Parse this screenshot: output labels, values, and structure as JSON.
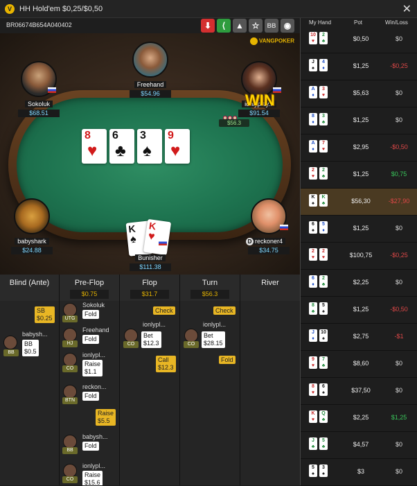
{
  "window": {
    "title": "HH Hold'em $0,25/$0,50",
    "logo_letter": "V",
    "close_glyph": "✕"
  },
  "toolbar": {
    "hand_id": "BR06674B654A040402",
    "buttons": [
      {
        "name": "download-icon",
        "glyph": "⬇",
        "bg": "#d32f2f"
      },
      {
        "name": "share-icon",
        "glyph": "⟨",
        "bg": "#2e9c3e"
      },
      {
        "name": "alert-icon",
        "glyph": "▲",
        "bg": "#555"
      },
      {
        "name": "star-icon",
        "glyph": "☆",
        "bg": "#555"
      },
      {
        "name": "bb-toggle",
        "glyph": "BB",
        "bg": "#555"
      },
      {
        "name": "eye-icon",
        "glyph": "◉",
        "bg": "#555"
      }
    ]
  },
  "table": {
    "brand": "VANGPOKER",
    "board": [
      {
        "rank": "8",
        "suit": "♥",
        "color": "red"
      },
      {
        "rank": "6",
        "suit": "♣",
        "color": "blk"
      },
      {
        "rank": "3",
        "suit": "♠",
        "color": "blk"
      },
      {
        "rank": "9",
        "suit": "♥",
        "color": "red"
      }
    ],
    "pot": "$56.3",
    "win_label": "WIN",
    "dealer_label": "D",
    "seats": {
      "sokoluk": {
        "name": "Sokoluk",
        "stack": "$68.51"
      },
      "freehand": {
        "name": "Freehand",
        "stack": "$54.96"
      },
      "ionly": {
        "name": "ionlyplay...",
        "stack": "$91.54"
      },
      "babyshark": {
        "name": "babyshark",
        "stack": "$24.88"
      },
      "reckoner": {
        "name": "reckoner4",
        "stack": "$34.75"
      },
      "bunisher": {
        "name": "Bunisher",
        "stack": "$111.38"
      }
    },
    "hero_cards": [
      {
        "rank": "K",
        "suit": "♠",
        "color": "blk"
      },
      {
        "rank": "K",
        "suit": "♥",
        "color": "red"
      }
    ]
  },
  "streets": {
    "headers": [
      {
        "title": "Blind (Ante)",
        "pot": ""
      },
      {
        "title": "Pre-Flop",
        "pot": "$0.75"
      },
      {
        "title": "Flop",
        "pot": "$31.7"
      },
      {
        "title": "Turn",
        "pot": "$56.3"
      },
      {
        "title": "River",
        "pot": ""
      }
    ],
    "blind": {
      "sb_label": "SB",
      "sb_amt": "$0.25",
      "bb_player": "babysh...",
      "bb_pos": "BB",
      "bb_label": "BB",
      "bb_amt": "$0.5"
    },
    "preflop": [
      {
        "player": "Sokoluk",
        "pos": "UTG",
        "action": "Fold",
        "amt": ""
      },
      {
        "player": "Freehand",
        "pos": "HJ",
        "action": "Fold",
        "amt": ""
      },
      {
        "player": "ionlypl...",
        "pos": "CO",
        "action": "Raise",
        "amt": "$1.1"
      },
      {
        "player": "reckon...",
        "pos": "BTN",
        "action": "Fold",
        "amt": ""
      },
      {
        "player": "",
        "pos": "",
        "action": "Raise",
        "amt": "$5.5"
      },
      {
        "player": "babysh...",
        "pos": "BB",
        "action": "Fold",
        "amt": ""
      },
      {
        "player": "ionlypl...",
        "pos": "CO",
        "action": "Raise",
        "amt": "$15.6"
      },
      {
        "player": "",
        "pos": "",
        "action": "Call",
        "amt": ""
      }
    ],
    "flop": {
      "check": "Check",
      "player": "ionlypl...",
      "pos": "CO",
      "bet_label": "Bet",
      "bet_amt": "$12.3",
      "call_label": "Call",
      "call_amt": "$12.3"
    },
    "turn": {
      "check": "Check",
      "player": "ionlypl...",
      "pos": "CO",
      "bet_label": "Bet",
      "bet_amt": "$28.15",
      "fold": "Fold"
    }
  },
  "history": {
    "headers": {
      "hand": "My Hand",
      "pot": "Pot",
      "wl": "Win/Loss"
    },
    "rows": [
      {
        "c1": "10",
        "s1": "♥",
        "col1": "red",
        "c2": "2",
        "s2": "♣",
        "col2": "grn",
        "pot": "$0,50",
        "wl": "$0",
        "wlc": "neutral"
      },
      {
        "c1": "J",
        "s1": "♠",
        "col1": "blk",
        "c2": "4",
        "s2": "♦",
        "col2": "blu",
        "pot": "$1,25",
        "wl": "-$0,25",
        "wlc": "neg"
      },
      {
        "c1": "A",
        "s1": "♦",
        "col1": "blu",
        "c2": "3",
        "s2": "♥",
        "col2": "red",
        "pot": "$5,63",
        "wl": "$0",
        "wlc": "neutral"
      },
      {
        "c1": "8",
        "s1": "♦",
        "col1": "blu",
        "c2": "3",
        "s2": "♣",
        "col2": "grn",
        "pot": "$1,25",
        "wl": "$0",
        "wlc": "neutral"
      },
      {
        "c1": "A",
        "s1": "♦",
        "col1": "blu",
        "c2": "7",
        "s2": "♥",
        "col2": "red",
        "pot": "$2,95",
        "wl": "-$0,50",
        "wlc": "neg"
      },
      {
        "c1": "2",
        "s1": "♥",
        "col1": "red",
        "c2": "2",
        "s2": "♣",
        "col2": "grn",
        "pot": "$1,25",
        "wl": "$0,75",
        "wlc": "pos"
      },
      {
        "c1": "K",
        "s1": "♠",
        "col1": "blk",
        "c2": "K",
        "s2": "♣",
        "col2": "grn",
        "pot": "$56,30",
        "wl": "-$27,90",
        "wlc": "neg",
        "hl": true
      },
      {
        "c1": "6",
        "s1": "♠",
        "col1": "blk",
        "c2": "5",
        "s2": "♦",
        "col2": "blu",
        "pot": "$1,25",
        "wl": "$0",
        "wlc": "neutral"
      },
      {
        "c1": "2",
        "s1": "♥",
        "col1": "red",
        "c2": "2",
        "s2": "♥",
        "col2": "red",
        "pot": "$100,75",
        "wl": "-$0,25",
        "wlc": "neg"
      },
      {
        "c1": "6",
        "s1": "♦",
        "col1": "blu",
        "c2": "2",
        "s2": "♣",
        "col2": "grn",
        "pot": "$2,25",
        "wl": "$0",
        "wlc": "neutral"
      },
      {
        "c1": "8",
        "s1": "♣",
        "col1": "grn",
        "c2": "5",
        "s2": "♠",
        "col2": "blk",
        "pot": "$1,25",
        "wl": "-$0,50",
        "wlc": "neg"
      },
      {
        "c1": "J",
        "s1": "♦",
        "col1": "blu",
        "c2": "10",
        "s2": "♠",
        "col2": "blk",
        "pot": "$2,75",
        "wl": "-$1",
        "wlc": "neg"
      },
      {
        "c1": "9",
        "s1": "♥",
        "col1": "red",
        "c2": "7",
        "s2": "♣",
        "col2": "grn",
        "pot": "$8,60",
        "wl": "$0",
        "wlc": "neutral"
      },
      {
        "c1": "8",
        "s1": "♥",
        "col1": "red",
        "c2": "6",
        "s2": "♠",
        "col2": "blk",
        "pot": "$37,50",
        "wl": "$0",
        "wlc": "neutral"
      },
      {
        "c1": "K",
        "s1": "♥",
        "col1": "red",
        "c2": "Q",
        "s2": "♣",
        "col2": "grn",
        "pot": "$2,25",
        "wl": "$1,25",
        "wlc": "pos"
      },
      {
        "c1": "J",
        "s1": "♣",
        "col1": "grn",
        "c2": "5",
        "s2": "♣",
        "col2": "grn",
        "pot": "$4,57",
        "wl": "$0",
        "wlc": "neutral"
      },
      {
        "c1": "5",
        "s1": "♠",
        "col1": "blk",
        "c2": "3",
        "s2": "♠",
        "col2": "blk",
        "pot": "$3",
        "wl": "$0",
        "wlc": "neutral"
      }
    ]
  },
  "colors": {
    "red": "#c62828",
    "blk": "#111111",
    "blu": "#1e4fc7",
    "grn": "#1f8a3a",
    "neg": "#e04848",
    "pos": "#39c55a",
    "neutral": "#d8d8d8"
  }
}
